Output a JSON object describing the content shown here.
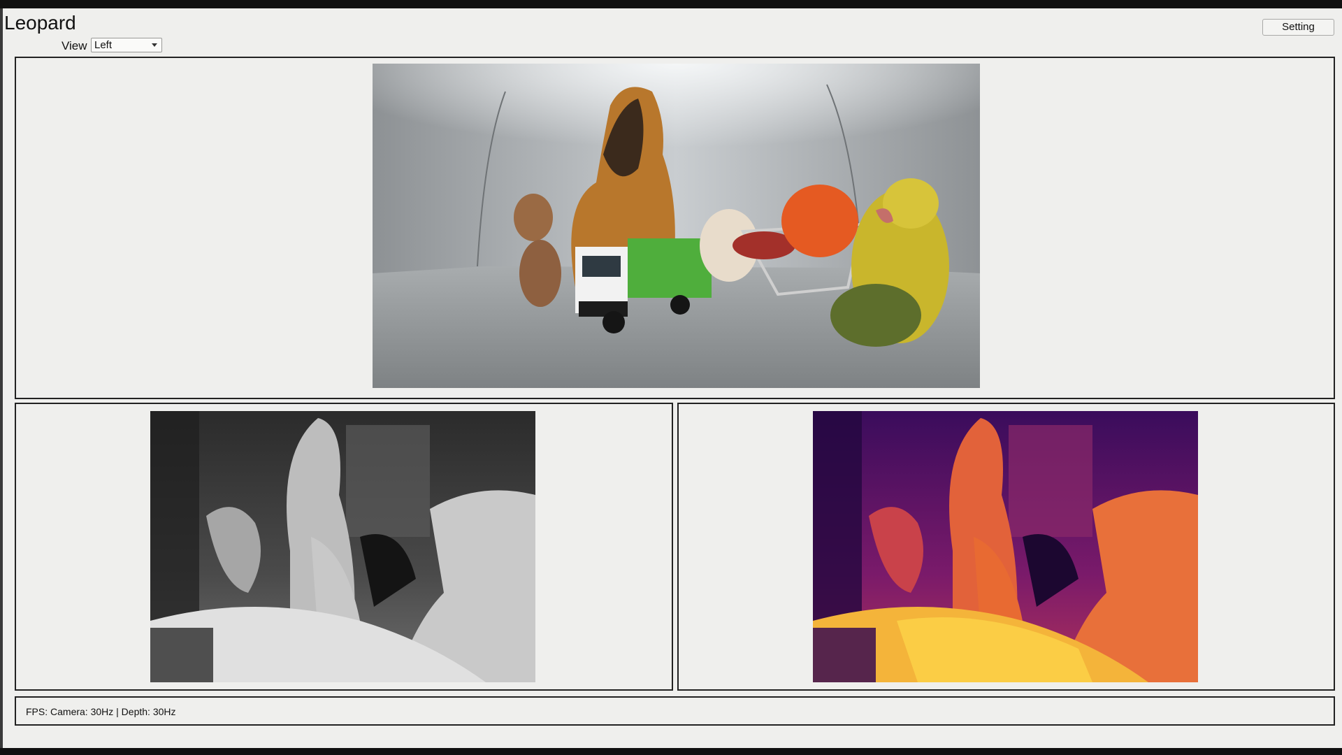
{
  "app": {
    "title": "Leopard"
  },
  "toolbar": {
    "view_label": "View",
    "view_selected": "Left",
    "setting_label": "Setting"
  },
  "panels": {
    "camera": {
      "icon": "camera-scene-image"
    },
    "depth_gray": {
      "icon": "grayscale-depth-map"
    },
    "depth_color": {
      "icon": "colormap-depth-map"
    }
  },
  "status": {
    "text": "FPS: Camera: 30Hz | Depth: 30Hz"
  },
  "colors": {
    "window_bg": "#efefed",
    "border": "#222222",
    "inferno_dark": "#2a0a4a",
    "inferno_bright": "#f9c33a"
  }
}
